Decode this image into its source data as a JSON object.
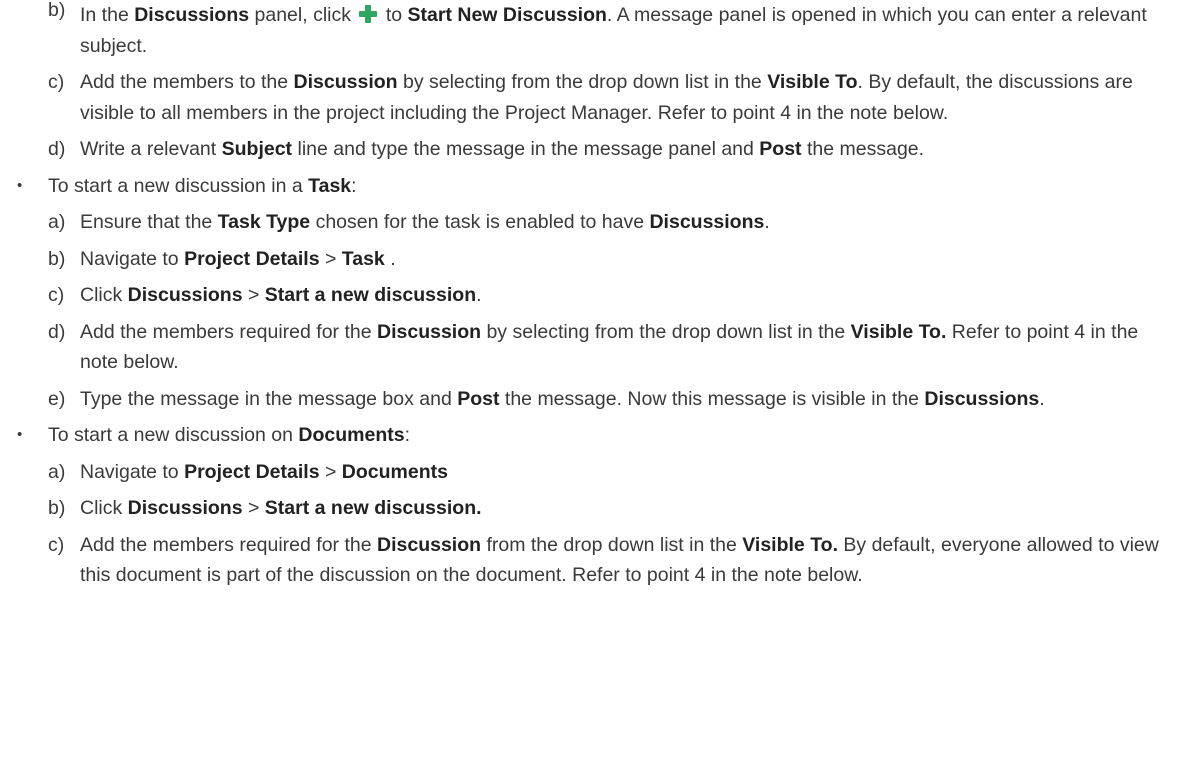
{
  "document": {
    "blocks": [
      {
        "kind": "item",
        "marker": "b)",
        "name": "step-b-start-new-discussion",
        "segments": [
          {
            "t": "In the "
          },
          {
            "t": "Discussions",
            "b": true
          },
          {
            "t": " panel, click "
          },
          {
            "icon": "plus-icon"
          },
          {
            "t": " to "
          },
          {
            "t": "Start New Discussion",
            "b": true
          },
          {
            "t": ". A message panel is opened in which you can enter a relevant subject."
          }
        ]
      },
      {
        "kind": "item",
        "marker": "c)",
        "name": "step-c-add-members",
        "segments": [
          {
            "t": "Add the members to the "
          },
          {
            "t": "Discussion",
            "b": true
          },
          {
            "t": " by selecting from the drop down list in the "
          },
          {
            "t": "Visible To",
            "b": true
          },
          {
            "t": ". By default, the discussions are visible to all members in the project including the Project Manager. Refer to point 4 in the note below."
          }
        ]
      },
      {
        "kind": "item",
        "marker": "d)",
        "name": "step-d-write-subject",
        "segments": [
          {
            "t": "Write a relevant "
          },
          {
            "t": "Subject",
            "b": true
          },
          {
            "t": " line and type the message in the message panel and "
          },
          {
            "t": "Post",
            "b": true
          },
          {
            "t": " the message."
          }
        ]
      },
      {
        "kind": "bullet",
        "marker": "•",
        "name": "bullet-task",
        "segments": [
          {
            "t": "To start a new discussion in a "
          },
          {
            "t": "Task",
            "b": true
          },
          {
            "t": ":"
          }
        ]
      },
      {
        "kind": "item",
        "marker": "a)",
        "name": "task-step-a",
        "segments": [
          {
            "t": "Ensure that the "
          },
          {
            "t": "Task Type",
            "b": true
          },
          {
            "t": " chosen for the task is enabled to have "
          },
          {
            "t": "Discussions",
            "b": true
          },
          {
            "t": "."
          }
        ]
      },
      {
        "kind": "item",
        "marker": "b)",
        "name": "task-step-b",
        "segments": [
          {
            "t": "Navigate to "
          },
          {
            "t": "Project Details",
            "b": true
          },
          {
            "t": " > "
          },
          {
            "t": "Task",
            "b": true
          },
          {
            "t": " ."
          }
        ]
      },
      {
        "kind": "item",
        "marker": "c)",
        "name": "task-step-c",
        "segments": [
          {
            "t": "Click "
          },
          {
            "t": "Discussions",
            "b": true
          },
          {
            "t": " > "
          },
          {
            "t": "Start a new discussion",
            "b": true
          },
          {
            "t": "."
          }
        ]
      },
      {
        "kind": "item",
        "marker": "d)",
        "name": "task-step-d",
        "segments": [
          {
            "t": "Add the members required for the "
          },
          {
            "t": "Discussion",
            "b": true
          },
          {
            "t": " by selecting from the drop down list in the "
          },
          {
            "t": "Visible To.",
            "b": true
          },
          {
            "t": "  Refer to point 4 in the note below."
          }
        ]
      },
      {
        "kind": "item",
        "marker": "e)",
        "name": "task-step-e",
        "segments": [
          {
            "t": "Type the message in the message box and "
          },
          {
            "t": "Post",
            "b": true
          },
          {
            "t": " the message. Now this message is visible in the "
          },
          {
            "t": "Discussions",
            "b": true
          },
          {
            "t": "."
          }
        ]
      },
      {
        "kind": "bullet",
        "marker": "•",
        "name": "bullet-documents",
        "segments": [
          {
            "t": "To start a new discussion on "
          },
          {
            "t": "Documents",
            "b": true
          },
          {
            "t": ":"
          }
        ]
      },
      {
        "kind": "item",
        "marker": "a)",
        "name": "doc-step-a",
        "segments": [
          {
            "t": "Navigate to "
          },
          {
            "t": "Project Details",
            "b": true
          },
          {
            "t": " > "
          },
          {
            "t": "Documents",
            "b": true
          }
        ]
      },
      {
        "kind": "item",
        "marker": "b)",
        "name": "doc-step-b",
        "segments": [
          {
            "t": "Click "
          },
          {
            "t": "Discussions",
            "b": true
          },
          {
            "t": " > "
          },
          {
            "t": "Start a new discussion.",
            "b": true
          }
        ]
      },
      {
        "kind": "item",
        "marker": "c)",
        "name": "doc-step-c",
        "segments": [
          {
            "t": "Add the members required for the "
          },
          {
            "t": "Discussion",
            "b": true
          },
          {
            "t": " from the drop down list in the "
          },
          {
            "t": "Visible To.",
            "b": true
          },
          {
            "t": " By default, everyone allowed to view this document is part of the discussion on the document. Refer to point 4 in the note below."
          }
        ]
      }
    ]
  }
}
